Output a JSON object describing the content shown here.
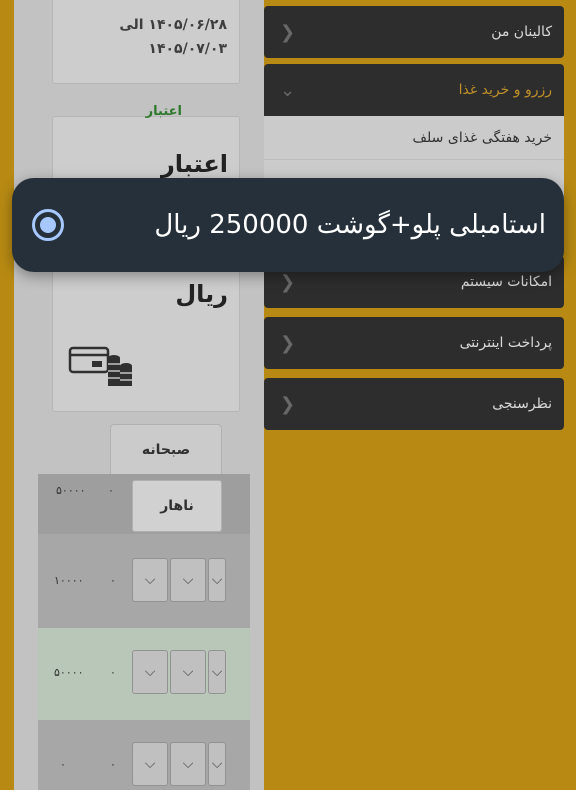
{
  "date_range": {
    "line1": "۱۴۰۵/۰۶/۲۸ الی",
    "line2": "۱۴۰۵/۰۷/۰۳"
  },
  "credit": {
    "label": "اعتبار",
    "title": "اعتبار",
    "currency": "ریال"
  },
  "tabs": {
    "breakfast": "صبحانه",
    "lunch": "ناهار"
  },
  "grid": {
    "row0_amount": "۵۰۰۰۰",
    "row0_count": "۰",
    "row1_amount": "۱۰۰۰۰",
    "row1_count": "۰",
    "row2_amount": "۵۰۰۰۰",
    "row2_count": "۰",
    "row3_amount": "۰",
    "row3_count": "۰",
    "dropdown_glyph": "⌵"
  },
  "menu": {
    "kalinan": "کالینان من",
    "reserve": "رزرو و خرید غذا",
    "weekly": "خرید هفتگی غذای سلف",
    "system": "امکانات سیستم",
    "payment": "پرداخت اینترنتی",
    "survey": "نظرسنجی",
    "reserve_color": "#E0A82A"
  },
  "popup": {
    "selected_option": "استامبلی پلو+گوشت 250000 ریال"
  }
}
